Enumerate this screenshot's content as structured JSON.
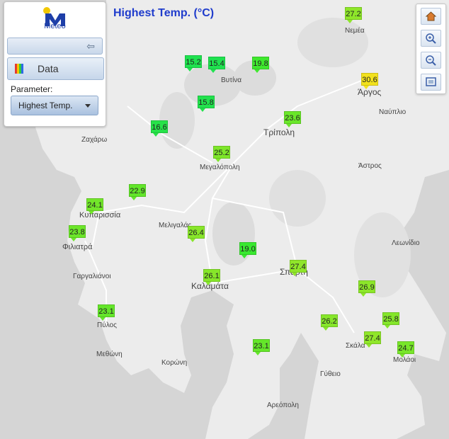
{
  "title": "Highest Temp. (°C)",
  "logo": {
    "text": "Meteo"
  },
  "panel": {
    "data_label": "Data",
    "param_label": "Parameter:",
    "param_value": "Highest Temp."
  },
  "zoom": {
    "home_icon": "home-icon",
    "zoom_in_icon": "zoom-in-icon",
    "zoom_out_icon": "zoom-out-icon",
    "extent_icon": "full-extent-icon"
  },
  "places": [
    {
      "name": "Νεμέα"
    },
    {
      "name": "Βυτίνα"
    },
    {
      "name": "Άργος"
    },
    {
      "name": "Ναύπλιο"
    },
    {
      "name": "Τρίπολη"
    },
    {
      "name": "Ζαχάρω"
    },
    {
      "name": "Μεγαλόπολη"
    },
    {
      "name": "Άστρος"
    },
    {
      "name": "Κυπαρισσία"
    },
    {
      "name": "Μελιγαλάς"
    },
    {
      "name": "Φιλιατρά"
    },
    {
      "name": "Λεωνίδιο"
    },
    {
      "name": "Σπάρτη"
    },
    {
      "name": "Καλαμάτα"
    },
    {
      "name": "Γαργαλιάνοι"
    },
    {
      "name": "Πύλος"
    },
    {
      "name": "Σκάλα"
    },
    {
      "name": "Μεθώνη"
    },
    {
      "name": "Κορώνη"
    },
    {
      "name": "Μολάοι"
    },
    {
      "name": "Γύθειο"
    },
    {
      "name": "Αρεόπολη"
    }
  ],
  "markers": [
    {
      "value": "27.2",
      "color": "#8ee62a"
    },
    {
      "value": "15.2",
      "color": "#1fe24f"
    },
    {
      "value": "15.4",
      "color": "#1fe24f"
    },
    {
      "value": "19.8",
      "color": "#3fe82e"
    },
    {
      "value": "30.6",
      "color": "#f2e11c"
    },
    {
      "value": "15.8",
      "color": "#22e24d"
    },
    {
      "value": "23.6",
      "color": "#6ae62a"
    },
    {
      "value": "16.6",
      "color": "#27e249"
    },
    {
      "value": "25.2",
      "color": "#7ee62a"
    },
    {
      "value": "22.9",
      "color": "#62e62a"
    },
    {
      "value": "24.1",
      "color": "#72e62a"
    },
    {
      "value": "23.8",
      "color": "#6ce62a"
    },
    {
      "value": "26.4",
      "color": "#88e62a"
    },
    {
      "value": "19.0",
      "color": "#39e830"
    },
    {
      "value": "27.4",
      "color": "#90e62a"
    },
    {
      "value": "26.1",
      "color": "#86e62a"
    },
    {
      "value": "26.9",
      "color": "#8ce62a"
    },
    {
      "value": "23.1",
      "color": "#64e62a"
    },
    {
      "value": "26.2",
      "color": "#86e62a"
    },
    {
      "value": "25.8",
      "color": "#84e62a"
    },
    {
      "value": "27.4",
      "color": "#90e62a"
    },
    {
      "value": "24.7",
      "color": "#78e62a"
    },
    {
      "value": "23.1",
      "color": "#64e62a"
    }
  ]
}
